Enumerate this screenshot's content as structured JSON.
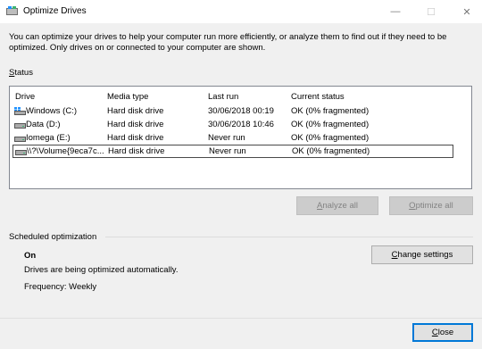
{
  "window": {
    "title": "Optimize Drives",
    "minimize_glyph": "—",
    "maximize_glyph": "☐",
    "close_glyph": "✕"
  },
  "description": "You can optimize your drives to help your computer run more efficiently, or analyze them to find out if they need to be optimized. Only drives on or connected to your computer are shown.",
  "status": {
    "label_prefix": "",
    "label_access": "S",
    "label_rest": "tatus",
    "columns": [
      "Drive",
      "Media type",
      "Last run",
      "Current status"
    ],
    "rows": [
      {
        "icon": "windows-drive-icon",
        "drive": "Windows (C:)",
        "media": "Hard disk drive",
        "last_run": "30/06/2018 00:19",
        "status": "OK (0% fragmented)"
      },
      {
        "icon": "hard-drive-icon",
        "drive": "Data (D:)",
        "media": "Hard disk drive",
        "last_run": "30/06/2018 10:46",
        "status": "OK (0% fragmented)"
      },
      {
        "icon": "hard-drive-icon",
        "drive": "Iomega (E:)",
        "media": "Hard disk drive",
        "last_run": "Never run",
        "status": "OK (0% fragmented)"
      },
      {
        "icon": "hard-drive-icon",
        "drive": "\\\\?\\Volume{9eca7c...",
        "media": "Hard disk drive",
        "last_run": "Never run",
        "status": "OK (0% fragmented)"
      }
    ],
    "analyze_all": {
      "access": "A",
      "rest": "nalyze all"
    },
    "optimize_all": {
      "access": "O",
      "rest": "ptimize all"
    }
  },
  "scheduled": {
    "label": "Scheduled optimization",
    "state": "On",
    "message": "Drives are being optimized automatically.",
    "frequency": "Frequency: Weekly",
    "change_settings": {
      "prefix": "",
      "access": "C",
      "rest": "hange settings"
    }
  },
  "footer": {
    "close": {
      "access": "C",
      "rest": "lose"
    }
  },
  "colors": {
    "accent": "#0078d7",
    "disabled_button": "#cccccc",
    "windows_icon": "#1e90ff",
    "drive_icon": "#555555"
  }
}
